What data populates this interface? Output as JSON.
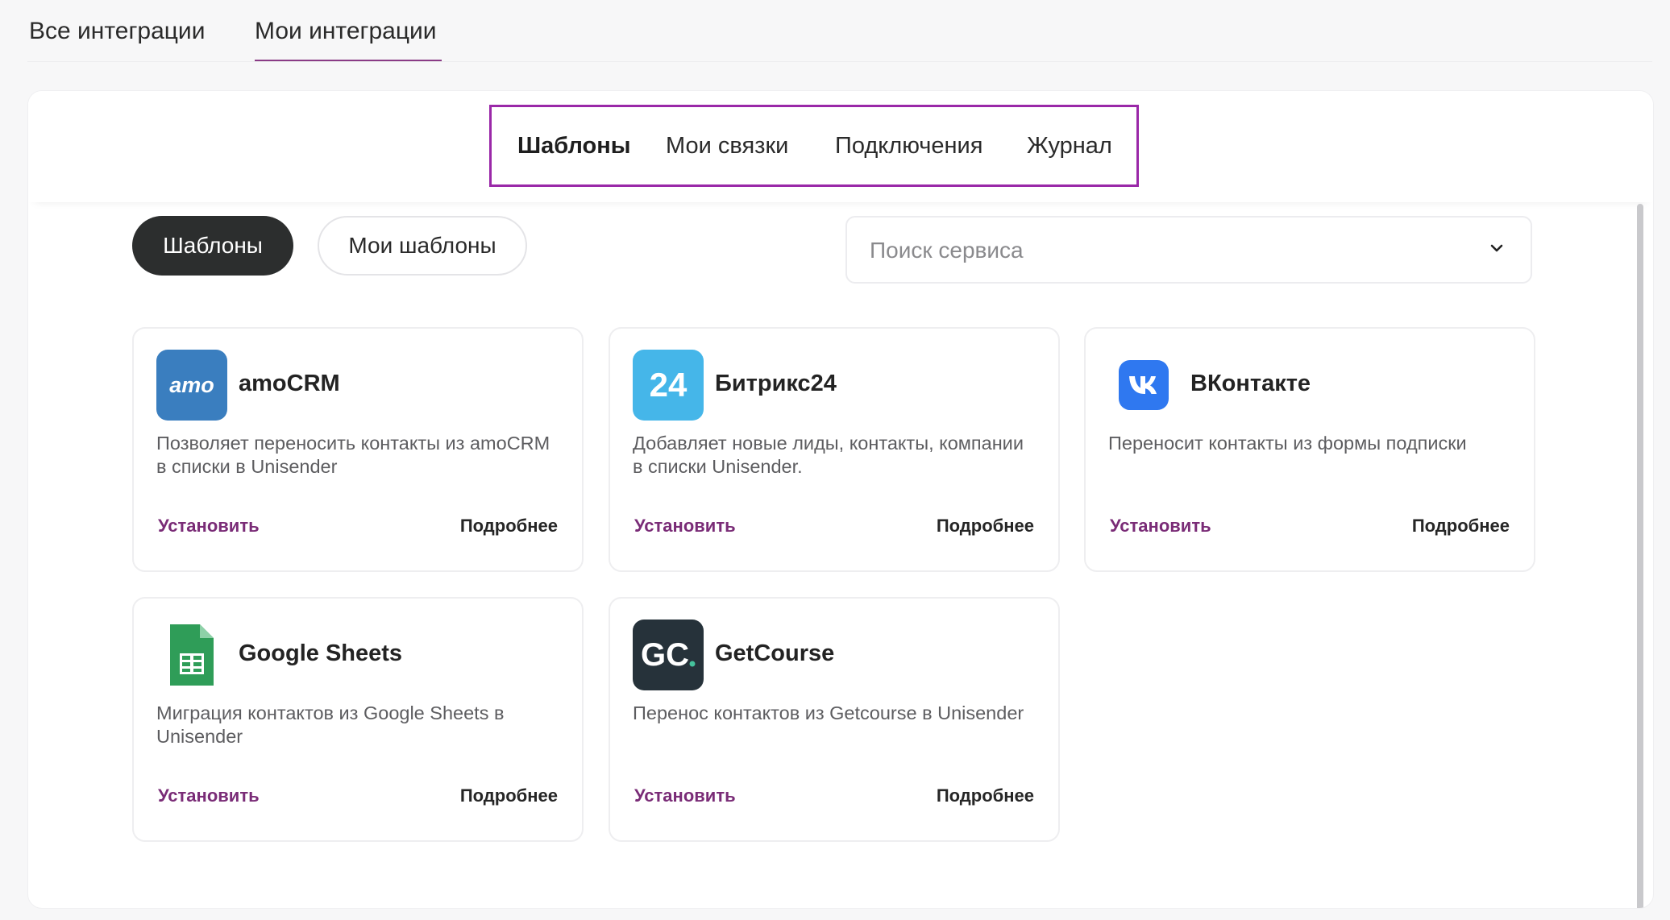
{
  "top_tabs": [
    {
      "label": "Все интеграции",
      "active": false
    },
    {
      "label": "Мои интеграции",
      "active": true
    }
  ],
  "sub_tabs": [
    {
      "label": "Шаблоны",
      "active": true
    },
    {
      "label": "Мои связки",
      "active": false
    },
    {
      "label": "Подключения",
      "active": false
    },
    {
      "label": "Журнал",
      "active": false
    }
  ],
  "filters": {
    "templates_label": "Шаблоны",
    "my_templates_label": "Мои шаблоны"
  },
  "search": {
    "placeholder": "Поиск сервиса",
    "icon": "chevron-down-icon"
  },
  "cards": [
    {
      "title": "amoCRM",
      "logo_text": "amo",
      "logo_color": "#3a7ebf",
      "description": "Позволяет переносить контакты из amoCRM в списки в Unisender",
      "install_label": "Установить",
      "more_label": "Подробнее"
    },
    {
      "title": "Битрикс24",
      "logo_text": "24",
      "logo_color": "#45b6e9",
      "description": "Добавляет новые лиды, контакты, компании в списки Unisender.",
      "install_label": "Установить",
      "more_label": "Подробнее"
    },
    {
      "title": "ВКонтакте",
      "logo_text": "",
      "logo_color": "#2f78f0",
      "description": "Переносит контакты из формы подписки",
      "install_label": "Установить",
      "more_label": "Подробнее"
    },
    {
      "title": "Google Sheets",
      "logo_text": "",
      "logo_color": "#2f9d58",
      "description": "Миграция контактов из Google Sheets в Unisender",
      "install_label": "Установить",
      "more_label": "Подробнее"
    },
    {
      "title": "GetCourse",
      "logo_text": "GC",
      "logo_color": "#26323a",
      "description": "Перенос контактов из Getcourse в Unisender",
      "install_label": "Установить",
      "more_label": "Подробнее"
    }
  ],
  "colors": {
    "accent": "#7a2c77",
    "highlight_border": "#9a28a8",
    "active_pill": "#2c2e2e"
  }
}
